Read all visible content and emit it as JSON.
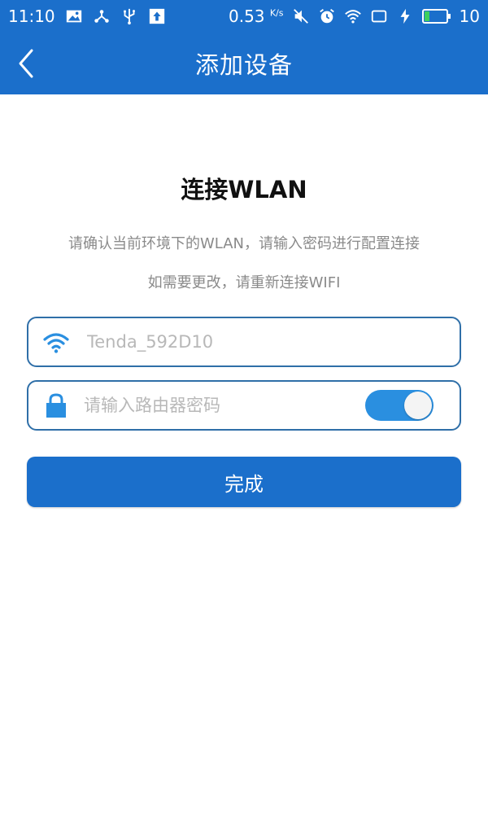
{
  "status_bar": {
    "time": "11:10",
    "net_speed": "0.53",
    "net_speed_unit": "K/s",
    "battery_level": "10",
    "icons_left": [
      "image-icon",
      "share-icon",
      "usb-icon",
      "upload-icon"
    ],
    "icons_right": [
      "mute-icon",
      "alarm-icon",
      "wifi-icon",
      "screen-icon",
      "charging-icon",
      "battery-icon"
    ]
  },
  "header": {
    "title": "添加设备",
    "back_icon": "chevron-left-icon"
  },
  "main": {
    "heading": "连接WLAN",
    "description_line1": "请确认当前环境下的WLAN，请输入密码进行配置连接",
    "description_line2": "如需要更改，请重新连接WIFI",
    "ssid_field": {
      "placeholder": "Tenda_592D10",
      "icon": "wifi-icon"
    },
    "password_field": {
      "placeholder": "请输入路由器密码",
      "icon": "lock-icon",
      "show_password_toggle": "on"
    },
    "submit_label": "完成"
  },
  "colors": {
    "primary": "#1b6fcb",
    "toggle": "#2a8fe0",
    "border": "#2f6fa8",
    "text_secondary": "#8a8a8a",
    "placeholder": "#b8b8b8"
  }
}
